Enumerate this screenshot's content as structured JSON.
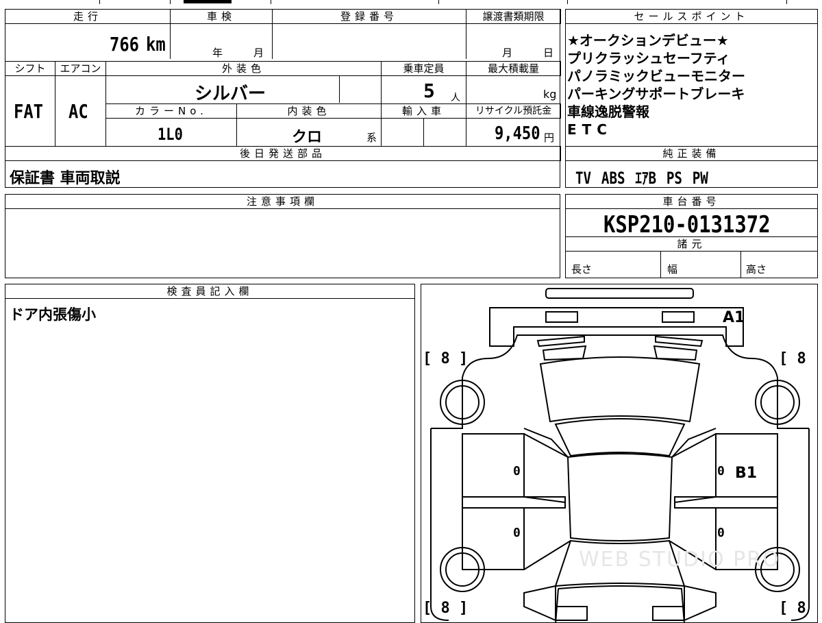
{
  "vehicle": {
    "mileage_label": "走行",
    "mileage_value": "766",
    "mileage_unit": "km",
    "inspection_label": "車検",
    "year_unit": "年",
    "month_unit": "月",
    "registration_label": "登録番号",
    "transfer_label": "譲渡書類期限",
    "day_unit": "日",
    "shift_label": "シフト",
    "shift_value": "FAT",
    "aircon_label": "エアコン",
    "aircon_value": "AC",
    "exterior_label": "外装色",
    "exterior_value": "シルバー",
    "capacity_label": "乗車定員",
    "capacity_value": "5",
    "capacity_unit": "人",
    "maxload_label": "最大積載量",
    "maxload_unit": "kg",
    "color_no_label": "カラーNo.",
    "color_no_value": "1L0",
    "interior_label": "内装色",
    "interior_value": "クロ",
    "interior_unit": "系",
    "import_label": "輸入車",
    "recycle_label": "リサイクル預託金",
    "recycle_value": "9,450",
    "recycle_unit": "円",
    "later_label": "後日発送部品",
    "later_value": "保証書 車両取説"
  },
  "sales": {
    "label": "セールスポイント",
    "points": [
      "★オークションデビュー★",
      "プリクラッシュセーフティ",
      "パノラミックビューモニター",
      "パーキングサポートブレーキ",
      "車線逸脱警報",
      "ETC"
    ]
  },
  "equipment": {
    "label": "純正装備",
    "value": "TV ABS ｴｱB PS PW"
  },
  "notes": {
    "label": "注意事項欄"
  },
  "chassis": {
    "label": "車台番号",
    "value": "KSP210-0131372",
    "spec_label": "諸元",
    "length_label": "長さ",
    "width_label": "幅",
    "height_label": "高さ"
  },
  "inspector": {
    "label": "検査員記入欄",
    "comment": "ドア内張傷小"
  },
  "diagram": {
    "marks": {
      "a1": "A1",
      "b1": "B1",
      "tire_fl": "[ 8 ]",
      "tire_fr": "[ 8 ]",
      "tire_rl": "[ 8 ]",
      "tire_rr": "[ 8 ]",
      "zero_1": "0",
      "zero_2": "0",
      "zero_3": "0",
      "zero_4": "0"
    },
    "watermark": "WEB STUDIO PRO"
  }
}
